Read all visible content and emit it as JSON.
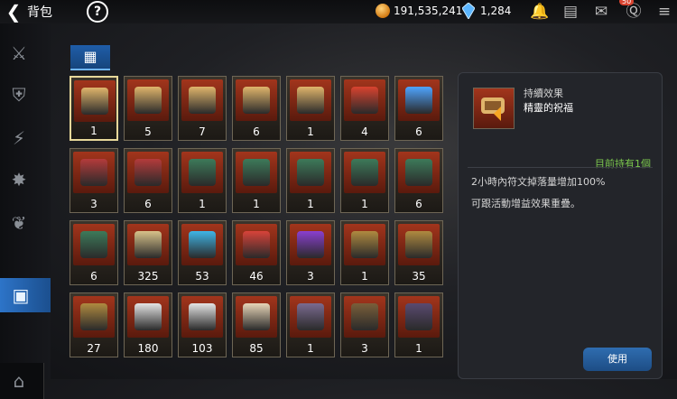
{
  "header": {
    "title": "背包",
    "back_icon": "chevron-left-icon",
    "help_label": "?",
    "gold": "191,535,241",
    "gems": "1,284",
    "badge": "50"
  },
  "tab": {
    "label": "▦"
  },
  "grid": [
    [
      "1",
      "5",
      "7",
      "6",
      "1",
      "4",
      "6"
    ],
    [
      "3",
      "6",
      "1",
      "1",
      "1",
      "1",
      "6"
    ],
    [
      "6",
      "325",
      "53",
      "46",
      "3",
      "1",
      "35"
    ],
    [
      "27",
      "180",
      "103",
      "85",
      "1",
      "3",
      "1"
    ]
  ],
  "detail": {
    "category": "持續效果",
    "name": "精靈的祝福",
    "owned": "目前持有1個",
    "desc1": "2小時內符文掉落量增加100%",
    "desc2": "可跟活動增益效果重疊。",
    "use_label": "使用"
  },
  "colors": {
    "accent": "#2d74c8",
    "owned_green": "#7cc94e",
    "slot_border": "#6e6655"
  }
}
